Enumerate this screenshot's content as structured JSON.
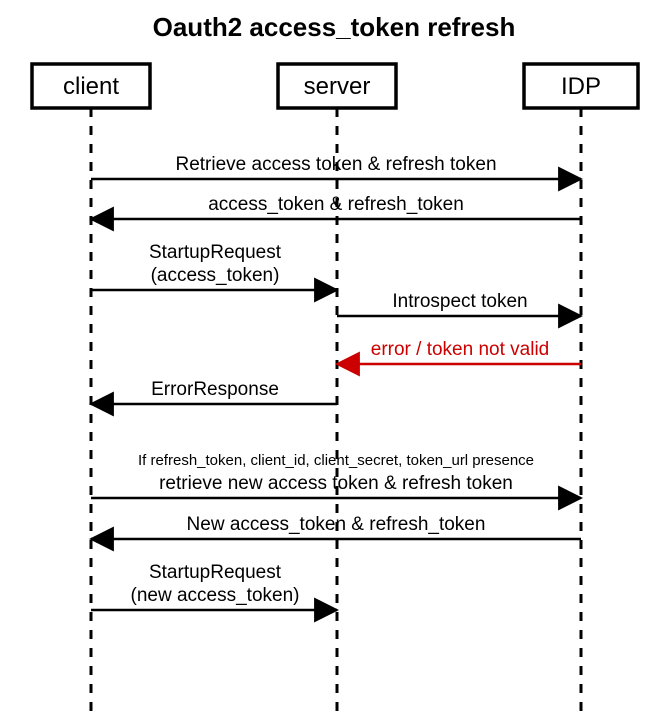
{
  "title": "Oauth2 access_token refresh",
  "participants": {
    "client": "client",
    "server": "server",
    "idp": "IDP"
  },
  "messages": {
    "m1": "Retrieve access token & refresh token",
    "m2": "access_token & refresh_token",
    "m3a": "StartupRequest",
    "m3b": "(access_token)",
    "m4": "Introspect token",
    "m5": "error / token not valid",
    "m6": "ErrorResponse",
    "m7note": "If refresh_token, client_id, client_secret, token_url presence",
    "m7": "retrieve new access token & refresh token",
    "m8": "New access_token & refresh_token",
    "m9a": "StartupRequest",
    "m9b": "(new access_token)"
  }
}
